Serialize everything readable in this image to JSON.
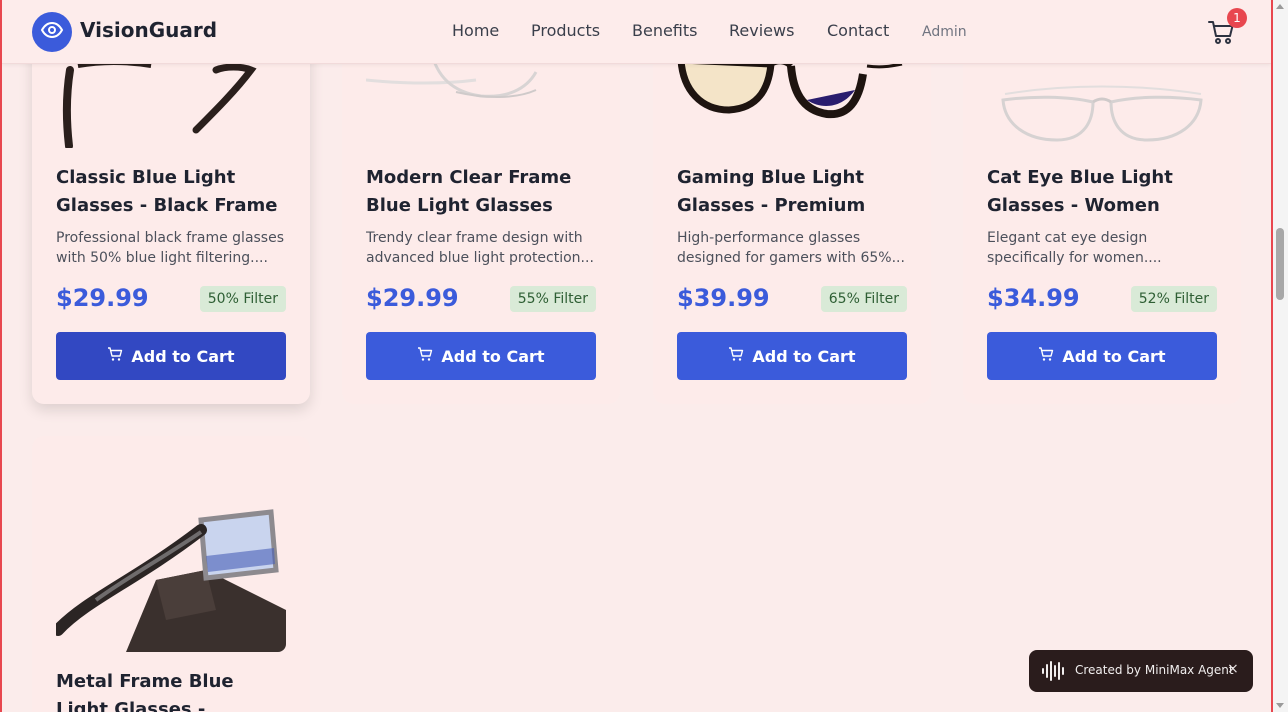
{
  "header": {
    "brand": "VisionGuard",
    "nav": [
      "Home",
      "Products",
      "Benefits",
      "Reviews",
      "Contact"
    ],
    "admin": "Admin",
    "cart_count": "1"
  },
  "products": [
    {
      "title_lines": [
        "Classic Blue Light",
        "Glasses - Black Frame"
      ],
      "desc_lines": [
        "Professional black frame glasses",
        "with 50% blue light filtering...."
      ],
      "price": "$29.99",
      "filter": "50% Filter",
      "button": "Add to Cart"
    },
    {
      "title_lines": [
        "Modern Clear Frame",
        "Blue Light Glasses"
      ],
      "desc_lines": [
        "Trendy clear frame design with",
        "advanced blue light protection..."
      ],
      "price": "$29.99",
      "filter": "55% Filter",
      "button": "Add to Cart"
    },
    {
      "title_lines": [
        "Gaming Blue Light",
        "Glasses - Premium"
      ],
      "desc_lines": [
        "High-performance glasses",
        "designed for gamers with 65%..."
      ],
      "price": "$39.99",
      "filter": "65% Filter",
      "button": "Add to Cart"
    },
    {
      "title_lines": [
        "Cat Eye Blue Light",
        "Glasses - Women"
      ],
      "desc_lines": [
        "Elegant cat eye design",
        "specifically for women...."
      ],
      "price": "$34.99",
      "filter": "52% Filter",
      "button": "Add to Cart"
    },
    {
      "title_lines": [
        "Metal Frame Blue",
        "Light Glasses -"
      ]
    }
  ],
  "toast": {
    "text": "Created by MiniMax Agent",
    "close": "×"
  },
  "icons": {
    "logo": "eye-icon",
    "cart": "shopping-cart-icon",
    "button": "cart-icon",
    "toast": "audio-wave-icon"
  },
  "colors": {
    "accent": "#3b5bdb",
    "page_bg": "#fbeceb",
    "badge_bg": "#d9ead7",
    "cart_badge": "#e8474f",
    "toast_bg": "#2a1c1c"
  }
}
